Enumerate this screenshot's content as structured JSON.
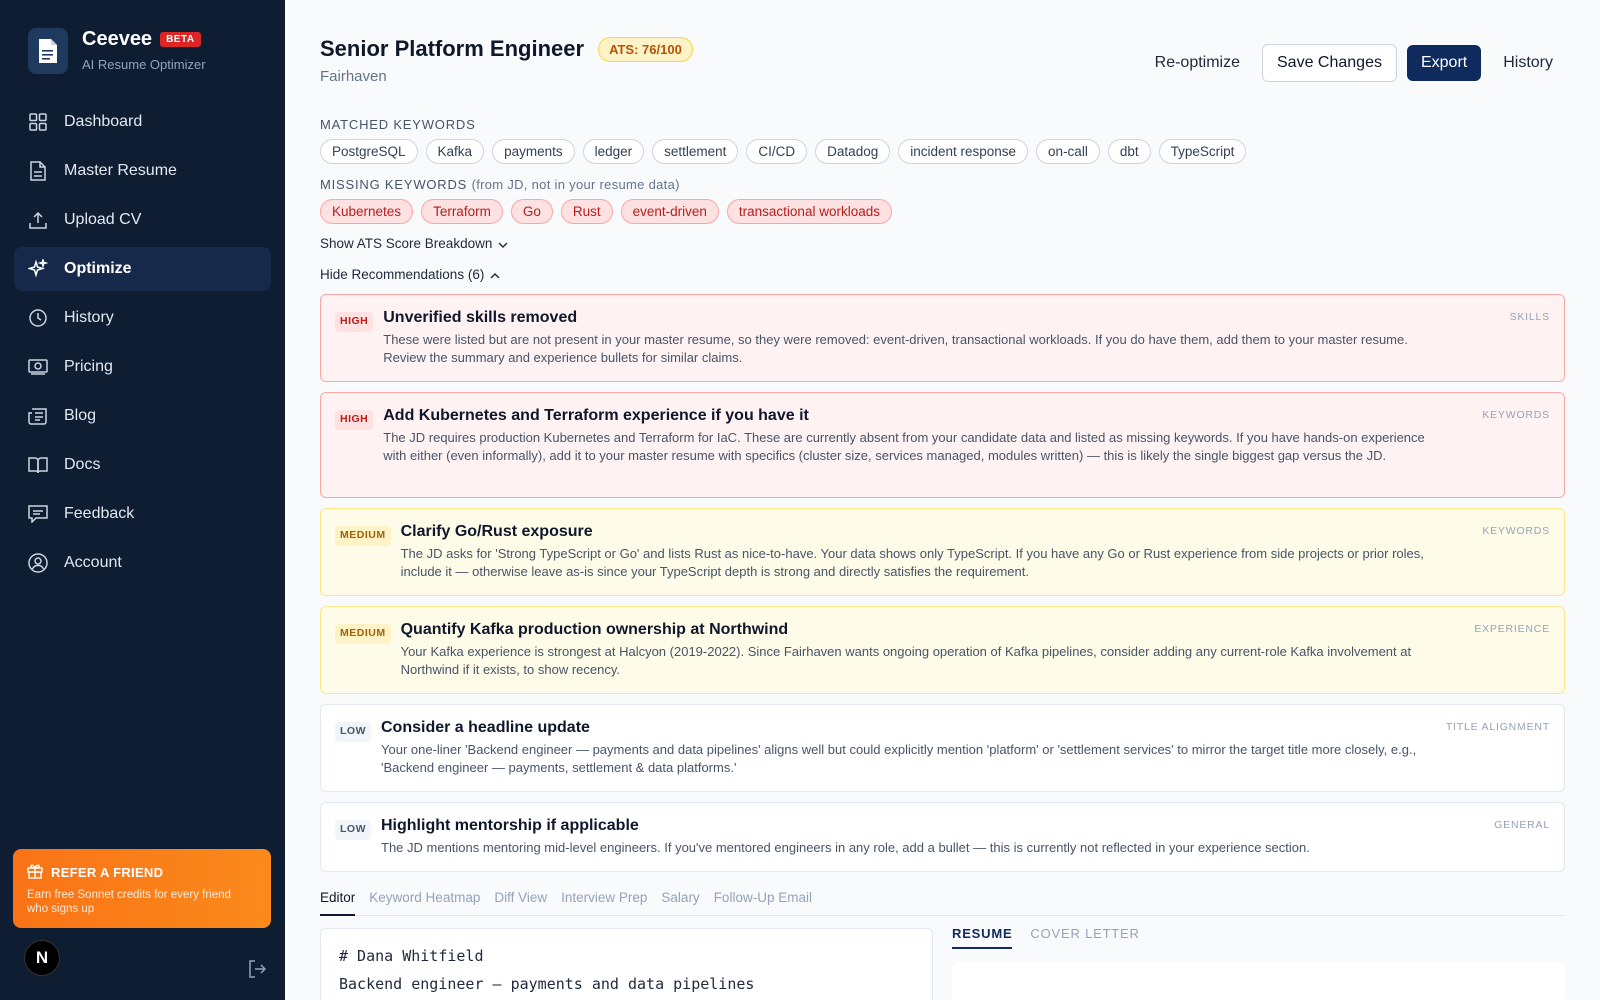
{
  "brand": {
    "name": "Ceevee",
    "badge": "BETA",
    "subtitle": "AI Resume Optimizer"
  },
  "sidebar": {
    "items": [
      {
        "label": "Dashboard",
        "icon": "grid-icon"
      },
      {
        "label": "Master Resume",
        "icon": "document-icon"
      },
      {
        "label": "Upload CV",
        "icon": "upload-icon"
      },
      {
        "label": "Optimize",
        "icon": "sparkles-icon",
        "active": true
      },
      {
        "label": "History",
        "icon": "clock-icon"
      },
      {
        "label": "Pricing",
        "icon": "money-icon"
      },
      {
        "label": "Blog",
        "icon": "newspaper-icon"
      },
      {
        "label": "Docs",
        "icon": "book-icon"
      },
      {
        "label": "Feedback",
        "icon": "chat-icon"
      },
      {
        "label": "Account",
        "icon": "user-circle-icon"
      }
    ],
    "refer": {
      "title": "REFER A FRIEND",
      "text": "Earn free Sonnet credits for every friend who signs up"
    },
    "avatar_initial": "N"
  },
  "header": {
    "title": "Senior Platform Engineer",
    "ats": "ATS: 76/100",
    "company": "Fairhaven",
    "reoptimize": "Re-optimize",
    "save": "Save Changes",
    "export": "Export",
    "history": "History"
  },
  "matched": {
    "label": "MATCHED KEYWORDS",
    "chips": [
      "PostgreSQL",
      "Kafka",
      "payments",
      "ledger",
      "settlement",
      "CI/CD",
      "Datadog",
      "incident response",
      "on-call",
      "dbt",
      "TypeScript"
    ]
  },
  "missing": {
    "label": "MISSING KEYWORDS",
    "note": "(from JD, not in your resume data)",
    "chips": [
      "Kubernetes",
      "Terraform",
      "Go",
      "Rust",
      "event-driven",
      "transactional workloads"
    ]
  },
  "toggles": {
    "breakdown": "Show ATS Score Breakdown",
    "recommendations": "Hide Recommendations (6)"
  },
  "recommendations": [
    {
      "severity": "HIGH",
      "level": "high",
      "title": "Unverified skills removed",
      "text": "These were listed but are not present in your master resume, so they were removed: event-driven, transactional workloads. If you do have them, add them to your master resume. Review the summary and experience bullets for similar claims.",
      "category": "SKILLS"
    },
    {
      "severity": "HIGH",
      "level": "high",
      "title": "Add Kubernetes and Terraform experience if you have it",
      "text": "The JD requires production Kubernetes and Terraform for IaC. These are currently absent from your candidate data and listed as missing keywords. If you have hands-on experience with either (even informally), add it to your master resume with specifics (cluster size, services managed, modules written) — this is likely the single biggest gap versus the JD.",
      "category": "KEYWORDS"
    },
    {
      "severity": "MEDIUM",
      "level": "medium",
      "title": "Clarify Go/Rust exposure",
      "text": "The JD asks for 'Strong TypeScript or Go' and lists Rust as nice-to-have. Your data shows only TypeScript. If you have any Go or Rust experience from side projects or prior roles, include it — otherwise leave as-is since your TypeScript depth is strong and directly satisfies the requirement.",
      "category": "KEYWORDS"
    },
    {
      "severity": "MEDIUM",
      "level": "medium",
      "title": "Quantify Kafka production ownership at Northwind",
      "text": "Your Kafka experience is strongest at Halcyon (2019-2022). Since Fairhaven wants ongoing operation of Kafka pipelines, consider adding any current-role Kafka involvement at Northwind if it exists, to show recency.",
      "category": "EXPERIENCE"
    },
    {
      "severity": "LOW",
      "level": "low",
      "title": "Consider a headline update",
      "text": "Your one-liner 'Backend engineer — payments and data pipelines' aligns well but could explicitly mention 'platform' or 'settlement services' to mirror the target title more closely, e.g., 'Backend engineer — payments, settlement & data platforms.'",
      "category": "TITLE ALIGNMENT"
    },
    {
      "severity": "LOW",
      "level": "low",
      "title": "Highlight mentorship if applicable",
      "text": "The JD mentions mentoring mid-level engineers. If you've mentored engineers in any role, add a bullet — this is currently not reflected in your experience section.",
      "category": "GENERAL"
    }
  ],
  "tabs": [
    "Editor",
    "Keyword Heatmap",
    "Diff View",
    "Interview Prep",
    "Salary",
    "Follow-Up Email"
  ],
  "editor": {
    "line1": "# Dana Whitfield",
    "line2": "Backend engineer — payments and data pipelines"
  },
  "preview_tabs": [
    "RESUME",
    "COVER LETTER"
  ]
}
